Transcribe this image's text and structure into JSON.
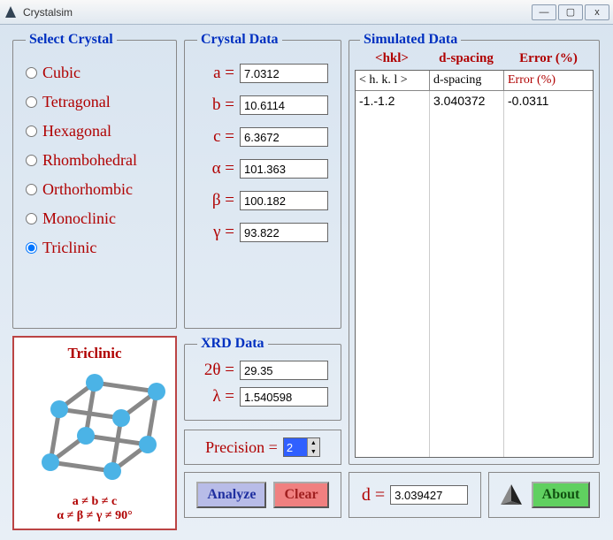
{
  "window": {
    "title": "Crystalsim",
    "min": "—",
    "max": "▢",
    "close": "x"
  },
  "select_crystal": {
    "legend": "Select Crystal",
    "options": [
      "Cubic",
      "Tetragonal",
      "Hexagonal",
      "Rhombohedral",
      "Orthorhombic",
      "Monoclinic",
      "Triclinic"
    ],
    "selected": "Triclinic"
  },
  "preview": {
    "name": "Triclinic",
    "formula1": "a ≠ b ≠ c",
    "formula2": "α ≠ β ≠ γ ≠ 90°"
  },
  "crystal_data": {
    "legend": "Crystal Data",
    "params": [
      {
        "label": "a =",
        "value": "7.0312"
      },
      {
        "label": "b =",
        "value": "10.6114"
      },
      {
        "label": "c =",
        "value": "6.3672"
      },
      {
        "label": "α =",
        "value": "101.363"
      },
      {
        "label": "β =",
        "value": "100.182"
      },
      {
        "label": "γ =",
        "value": "93.822"
      }
    ]
  },
  "xrd_data": {
    "legend": "XRD Data",
    "params": [
      {
        "label": "2θ =",
        "value": "29.35"
      },
      {
        "label": "λ =",
        "value": "1.540598"
      }
    ]
  },
  "precision": {
    "label": "Precision =",
    "value": "2"
  },
  "buttons": {
    "analyze": "Analyze",
    "clear": "Clear",
    "about": "About"
  },
  "sim": {
    "legend": "Simulated Data",
    "head": [
      "<hkl>",
      "d-spacing",
      "Error (%)"
    ],
    "cols": [
      "< h. k. l >",
      "d-spacing",
      "Error (%)"
    ],
    "rows": [
      {
        "hkl": "-1.-1.2",
        "d": "3.040372",
        "err": "-0.0311"
      }
    ]
  },
  "d_out": {
    "label": "d =",
    "value": "3.039427"
  }
}
